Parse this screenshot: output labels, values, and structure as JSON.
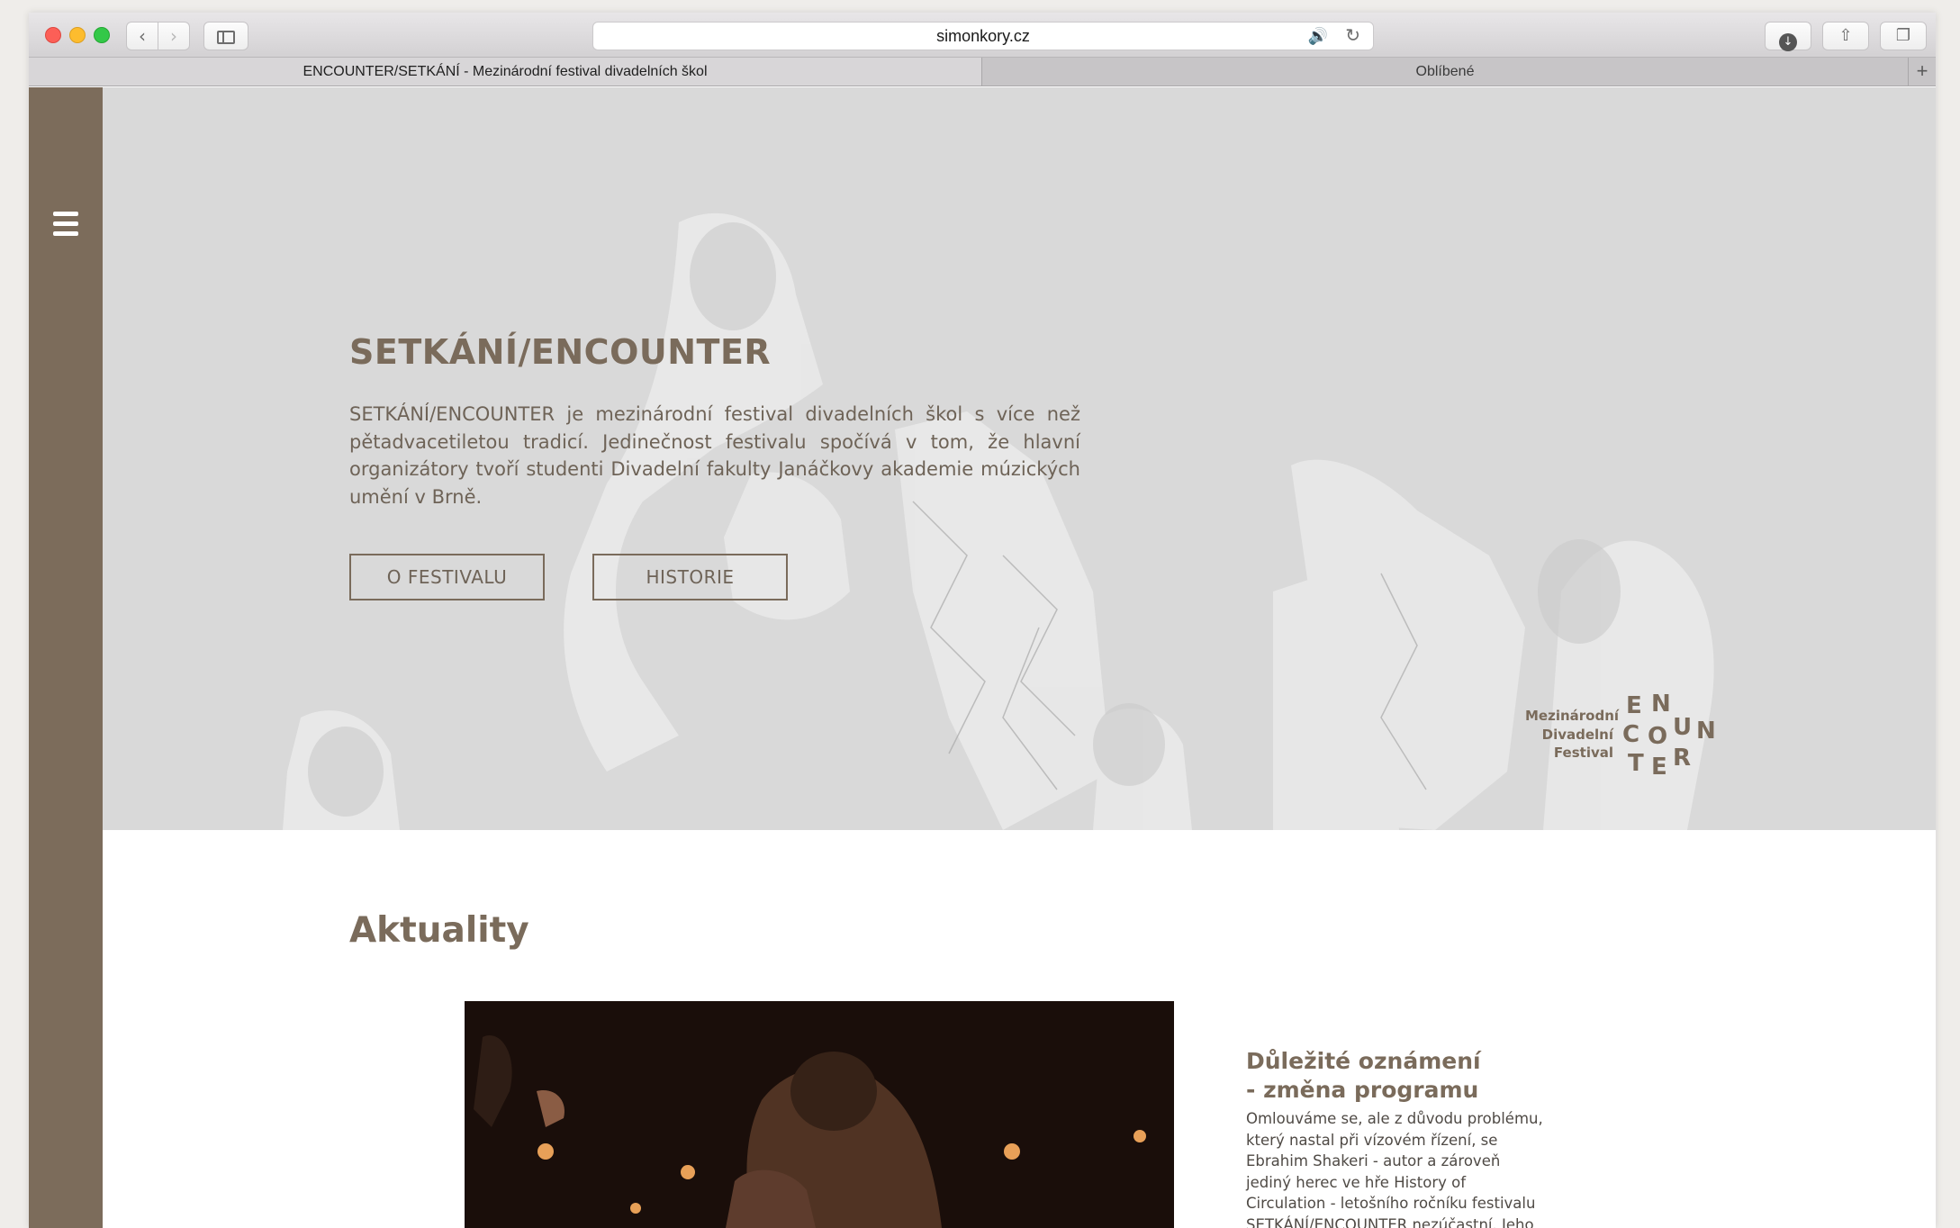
{
  "browser": {
    "url": "simonkory.cz",
    "tabs": [
      {
        "label": "ENCOUNTER/SETKÁNÍ - Mezinárodní festival divadelních škol",
        "active": true
      },
      {
        "label": "Oblíbené",
        "active": false
      }
    ]
  },
  "hero": {
    "title": "SETKÁNÍ/ENCOUNTER",
    "description": "SETKÁNÍ/ENCOUNTER je mezinárodní festival divadelních škol s více než pětadvacetiletou tradicí. Jedinečnost festivalu spočívá v tom, že hlavní organizátory tvoří studenti Divadelní fakulty Janáčkovy akademie múzických umění v Brně.",
    "buttons": {
      "festival": "O FESTIVALU",
      "historie": "HISTORIE"
    }
  },
  "logo": {
    "line1": "Mezinárodní",
    "line2": "Divadelní",
    "line3": "Festival",
    "letters": [
      "E",
      "N",
      "C",
      "O",
      "U",
      "N",
      "T",
      "E",
      "R"
    ]
  },
  "news": {
    "heading": "Aktuality",
    "item": {
      "title_line1": "Důležité oznámení",
      "title_line2": "- změna programu",
      "body": "Omlouváme se, ale z důvodu problému, který nastal při vízovém řízení, se Ebrahim Shakeri - autor a zároveň jediný herec ve hře History of Circulation - letošního ročníku festivalu SETKÁNÍ/ENCOUNTER nezúčastní. Jeho představení proto tímto musíme zrušit."
    }
  },
  "colors": {
    "brand": "#7c6c5b",
    "hero_bg": "#d9d9d9",
    "text_brown": "#7a6b5b"
  }
}
